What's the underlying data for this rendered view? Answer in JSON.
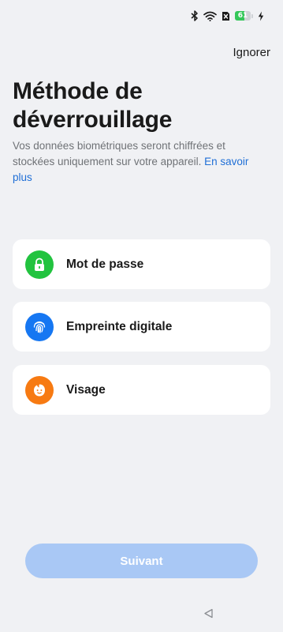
{
  "status_bar": {
    "battery_level": "61",
    "icons": [
      "bluetooth-icon",
      "wifi-icon",
      "sim-off-icon",
      "battery-icon",
      "charging-icon"
    ]
  },
  "header": {
    "skip_label": "Ignorer"
  },
  "page": {
    "title": "Méthode de déverrouillage",
    "subtitle": "Vos données biométriques seront chiffrées et stockées uniquement sur votre appareil.",
    "learn_more": "En savoir plus"
  },
  "options": [
    {
      "label": "Mot de passe",
      "icon": "lock-icon",
      "color": "#22c33f"
    },
    {
      "label": "Empreinte digitale",
      "icon": "fingerprint-icon",
      "color": "#1677f2"
    },
    {
      "label": "Visage",
      "icon": "face-icon",
      "color": "#f77a12"
    }
  ],
  "footer": {
    "next_label": "Suivant",
    "next_enabled": false,
    "next_color": "#a9c8f5"
  },
  "colors": {
    "background": "#f0f1f4",
    "link": "#1f6fd6"
  }
}
